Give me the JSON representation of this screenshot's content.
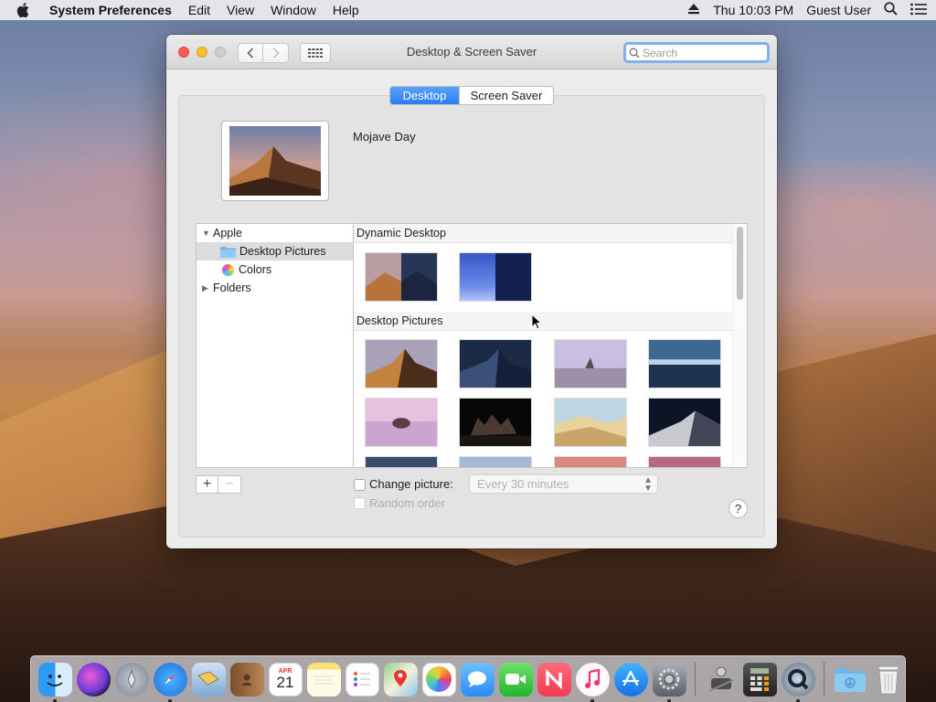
{
  "menubar": {
    "app_name": "System Preferences",
    "menus": [
      "Edit",
      "View",
      "Window",
      "Help"
    ],
    "clock": "Thu 10:03 PM",
    "user": "Guest User"
  },
  "window": {
    "title": "Desktop & Screen Saver",
    "search_placeholder": "Search"
  },
  "tabs": [
    {
      "label": "Desktop",
      "selected": true
    },
    {
      "label": "Screen Saver",
      "selected": false
    }
  ],
  "current_wallpaper": "Mojave Day",
  "sources": [
    {
      "label": "Apple",
      "expanded": true
    },
    {
      "label": "Desktop Pictures",
      "selected": true
    },
    {
      "label": "Colors"
    },
    {
      "label": "Folders",
      "expanded": false
    }
  ],
  "sections": [
    {
      "title": "Dynamic Desktop",
      "count": 2
    },
    {
      "title": "Desktop Pictures",
      "count_visible": 12
    }
  ],
  "controls": {
    "add": "+",
    "remove": "−",
    "change_picture_label": "Change picture:",
    "change_picture_checked": false,
    "random_order_label": "Random order",
    "interval": "Every 30 minutes",
    "help": "?"
  },
  "dock": {
    "items": [
      "finder-icon",
      "siri-icon",
      "launchpad-icon",
      "safari-icon",
      "mail-icon",
      "contacts-icon",
      "calendar-icon",
      "notes-icon",
      "reminders-icon",
      "maps-icon",
      "photos-icon",
      "messages-icon",
      "facetime-icon",
      "news-icon",
      "music-icon",
      "app-store-icon",
      "system-preferences-icon",
      "utility-icon",
      "calculator-icon",
      "quicktime-icon",
      "downloads-folder-icon",
      "trash-icon"
    ],
    "calendar_month": "APR",
    "calendar_day": "21"
  },
  "colors": {
    "accent": "#2a7ef3",
    "close": "#fe5f57",
    "minimize": "#febc2e"
  }
}
